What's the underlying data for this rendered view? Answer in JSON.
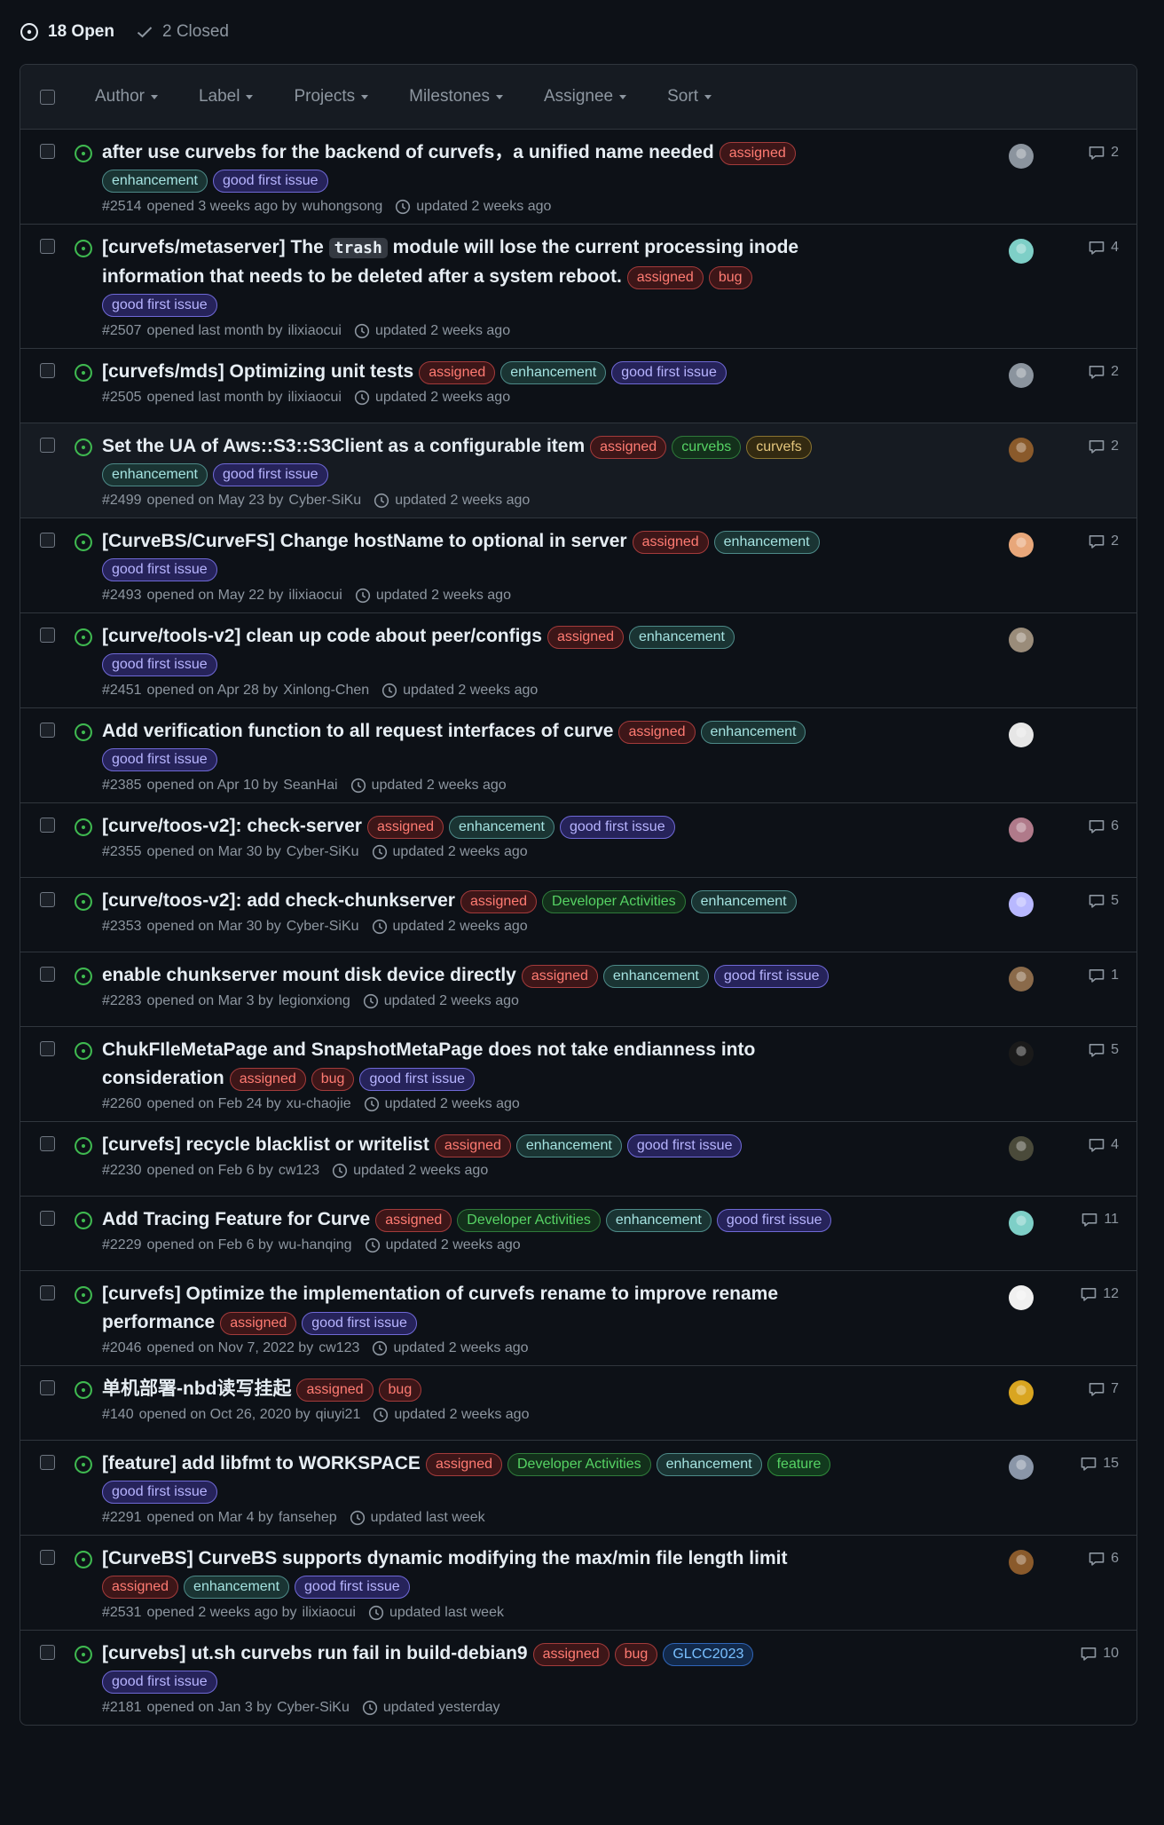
{
  "states": {
    "open_label": "18 Open",
    "closed_label": "2 Closed"
  },
  "filters": [
    "Author",
    "Label",
    "Projects",
    "Milestones",
    "Assignee",
    "Sort"
  ],
  "label_colors": {
    "assigned": {
      "fg": "#ff7b72",
      "bg": "#3d1618",
      "border": "#a33b3b"
    },
    "enhancement": {
      "fg": "#a5e3e1",
      "bg": "#1a3433",
      "border": "#4d8a88"
    },
    "good first issue": {
      "fg": "#b7b4ff",
      "bg": "#26235a",
      "border": "#6f69d6"
    },
    "bug": {
      "fg": "#ff7b72",
      "bg": "#3d1618",
      "border": "#a33b3b"
    },
    "curvebs": {
      "fg": "#56d364",
      "bg": "#13301b",
      "border": "#2f7a3a"
    },
    "curvefs": {
      "fg": "#e3c57c",
      "bg": "#332a11",
      "border": "#8a7431"
    },
    "Developer Activities": {
      "fg": "#56d364",
      "bg": "#13301b",
      "border": "#2f7a3a"
    },
    "feature": {
      "fg": "#56d364",
      "bg": "#123a1e",
      "border": "#2f8a3a"
    },
    "GLCC2023": {
      "fg": "#79c0ff",
      "bg": "#12294a",
      "border": "#2f65b8"
    }
  },
  "issues": [
    {
      "title": "after use curvebs for the backend of curvefs，a unified name needed",
      "inline_labels": [
        "assigned"
      ],
      "below_labels": [
        "enhancement",
        "good first issue"
      ],
      "number": "#2514",
      "opened": "opened 3 weeks ago by",
      "author": "wuhongsong",
      "updated": "updated 2 weeks ago",
      "comments": "2",
      "avatar_color": "#8b949e",
      "highlight": false
    },
    {
      "title": "[curvefs/metaserver] The",
      "code": "trash",
      "title_rest": "module will lose the current processing inode information that needs to be deleted after a system reboot.",
      "inline_labels": [
        "assigned",
        "bug"
      ],
      "below_labels": [
        "good first issue"
      ],
      "number": "#2507",
      "opened": "opened last month by",
      "author": "ilixiaocui",
      "updated": "updated 2 weeks ago",
      "comments": "4",
      "avatar_color": "#7ecfc7",
      "highlight": false
    },
    {
      "title": "[curvefs/mds] Optimizing unit tests",
      "inline_labels": [
        "assigned",
        "enhancement",
        "good first issue"
      ],
      "below_labels": [],
      "number": "#2505",
      "opened": "opened last month by",
      "author": "ilixiaocui",
      "updated": "updated 2 weeks ago",
      "comments": "2",
      "avatar_color": "#8b949e",
      "highlight": false
    },
    {
      "title": "Set the UA of Aws::S3::S3Client as a configurable item",
      "inline_labels": [
        "assigned",
        "curvebs",
        "curvefs"
      ],
      "below_labels": [
        "enhancement",
        "good first issue"
      ],
      "number": "#2499",
      "opened": "opened on May 23 by",
      "author": "Cyber-SiKu",
      "updated": "updated 2 weeks ago",
      "comments": "2",
      "avatar_color": "#8a5a2b",
      "highlight": true
    },
    {
      "title": "[CurveBS/CurveFS] Change hostName to optional in server",
      "inline_labels": [
        "assigned",
        "enhancement"
      ],
      "below_labels": [
        "good first issue"
      ],
      "number": "#2493",
      "opened": "opened on May 22 by",
      "author": "ilixiaocui",
      "updated": "updated 2 weeks ago",
      "comments": "2",
      "avatar_color": "#e8a77a",
      "highlight": false
    },
    {
      "title": "[curve/tools-v2] clean up code about peer/configs",
      "inline_labels": [
        "assigned",
        "enhancement"
      ],
      "below_labels": [
        "good first issue"
      ],
      "number": "#2451",
      "opened": "opened on Apr 28 by",
      "author": "Xinlong-Chen",
      "updated": "updated 2 weeks ago",
      "comments": "",
      "avatar_color": "#9a8c7a",
      "highlight": false
    },
    {
      "title": "Add verification function to all request interfaces of curve",
      "inline_labels": [
        "assigned",
        "enhancement"
      ],
      "below_labels": [
        "good first issue"
      ],
      "number": "#2385",
      "opened": "opened on Apr 10 by",
      "author": "SeanHai",
      "updated": "updated 2 weeks ago",
      "comments": "",
      "avatar_color": "#e6e6e6",
      "highlight": false
    },
    {
      "title": "[curve/toos-v2]: check-server",
      "inline_labels": [
        "assigned",
        "enhancement",
        "good first issue"
      ],
      "below_labels": [],
      "number": "#2355",
      "opened": "opened on Mar 30 by",
      "author": "Cyber-SiKu",
      "updated": "updated 2 weeks ago",
      "comments": "6",
      "avatar_color": "#b07a8a",
      "highlight": false
    },
    {
      "title": "[curve/toos-v2]: add check-chunkserver",
      "inline_labels": [
        "assigned",
        "Developer Activities",
        "enhancement"
      ],
      "below_labels": [],
      "number": "#2353",
      "opened": "opened on Mar 30 by",
      "author": "Cyber-SiKu",
      "updated": "updated 2 weeks ago",
      "comments": "5",
      "avatar_color": "#b8b8ff",
      "highlight": false
    },
    {
      "title": "enable chunkserver mount disk device directly",
      "inline_labels": [
        "assigned",
        "enhancement",
        "good first issue"
      ],
      "below_labels": [],
      "number": "#2283",
      "opened": "opened on Mar 3 by",
      "author": "legionxiong",
      "updated": "updated 2 weeks ago",
      "comments": "1",
      "avatar_color": "#8a6a4a",
      "highlight": false
    },
    {
      "title": "ChukFIleMetaPage and SnapshotMetaPage does not take endianness into consideration",
      "inline_labels": [
        "assigned",
        "bug",
        "good first issue"
      ],
      "below_labels": [],
      "number": "#2260",
      "opened": "opened on Feb 24 by",
      "author": "xu-chaojie",
      "updated": "updated 2 weeks ago",
      "comments": "5",
      "avatar_color": "#1a1a1a",
      "highlight": false
    },
    {
      "title": "[curvefs] recycle blacklist or writelist",
      "inline_labels": [
        "assigned",
        "enhancement",
        "good first issue"
      ],
      "below_labels": [],
      "number": "#2230",
      "opened": "opened on Feb 6 by",
      "author": "cw123",
      "updated": "updated 2 weeks ago",
      "comments": "4",
      "avatar_color": "#4a4a3a",
      "highlight": false
    },
    {
      "title": "Add Tracing Feature for Curve",
      "inline_labels": [
        "assigned",
        "Developer Activities",
        "enhancement",
        "good first issue"
      ],
      "below_labels": [],
      "number": "#2229",
      "opened": "opened on Feb 6 by",
      "author": "wu-hanqing",
      "updated": "updated 2 weeks ago",
      "comments": "11",
      "avatar_color": "#7ecfc7",
      "highlight": false
    },
    {
      "title": "[curvefs] Optimize the implementation of curvefs rename to improve rename performance",
      "inline_labels": [
        "assigned",
        "good first issue"
      ],
      "below_labels": [],
      "number": "#2046",
      "opened": "opened on Nov 7, 2022 by",
      "author": "cw123",
      "updated": "updated 2 weeks ago",
      "comments": "12",
      "avatar_color": "#f0f0f0",
      "highlight": false
    },
    {
      "title": "单机部署-nbd读写挂起",
      "inline_labels": [
        "assigned",
        "bug"
      ],
      "below_labels": [],
      "number": "#140",
      "opened": "opened on Oct 26, 2020 by",
      "author": "qiuyi21",
      "updated": "updated 2 weeks ago",
      "comments": "7",
      "avatar_color": "#d9a520",
      "highlight": false
    },
    {
      "title": "[feature] add libfmt to WORKSPACE",
      "inline_labels": [
        "assigned",
        "Developer Activities",
        "enhancement",
        "feature"
      ],
      "below_labels": [
        "good first issue"
      ],
      "number": "#2291",
      "opened": "opened on Mar 4 by",
      "author": "fansehep",
      "updated": "updated last week",
      "comments": "15",
      "avatar_color": "#8a96a8",
      "highlight": false
    },
    {
      "title": "[CurveBS] CurveBS supports dynamic modifying the max/min file length limit",
      "inline_labels": [],
      "below_labels": [
        "assigned",
        "enhancement",
        "good first issue"
      ],
      "number": "#2531",
      "opened": "opened 2 weeks ago by",
      "author": "ilixiaocui",
      "updated": "updated last week",
      "comments": "6",
      "avatar_color": "#8a5a2b",
      "highlight": false
    },
    {
      "title": "[curvebs] ut.sh curvebs run fail in build-debian9",
      "inline_labels": [
        "assigned",
        "bug",
        "GLCC2023"
      ],
      "below_labels": [
        "good first issue"
      ],
      "number": "#2181",
      "opened": "opened on Jan 3 by",
      "author": "Cyber-SiKu",
      "updated": "updated yesterday",
      "comments": "10",
      "avatar_color": "",
      "highlight": false
    }
  ]
}
